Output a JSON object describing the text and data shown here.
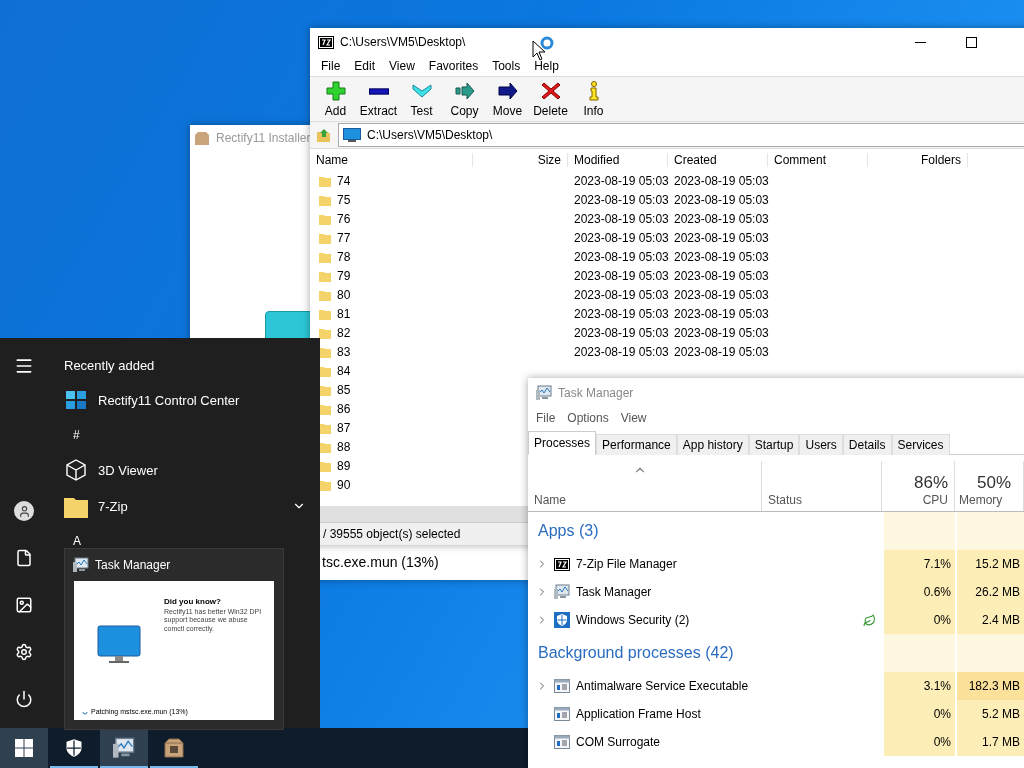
{
  "installer": {
    "title": "Rectify11 Installer",
    "status": "tsc.exe.mun (13%)"
  },
  "zip": {
    "title": "C:\\Users\\VM5\\Desktop\\",
    "menu": [
      "File",
      "Edit",
      "View",
      "Favorites",
      "Tools",
      "Help"
    ],
    "toolbar": [
      {
        "kind": "add",
        "label": "Add"
      },
      {
        "kind": "extract",
        "label": "Extract"
      },
      {
        "kind": "test",
        "label": "Test"
      },
      {
        "kind": "copy",
        "label": "Copy"
      },
      {
        "kind": "move",
        "label": "Move"
      },
      {
        "kind": "delete",
        "label": "Delete"
      },
      {
        "kind": "info",
        "label": "Info"
      }
    ],
    "address": "C:\\Users\\VM5\\Desktop\\",
    "columns": [
      "Name",
      "Size",
      "Modified",
      "Created",
      "Comment",
      "Folders"
    ],
    "rows": [
      {
        "name": "74",
        "modified": "2023-08-19 05:03",
        "created": "2023-08-19 05:03"
      },
      {
        "name": "75",
        "modified": "2023-08-19 05:03",
        "created": "2023-08-19 05:03"
      },
      {
        "name": "76",
        "modified": "2023-08-19 05:03",
        "created": "2023-08-19 05:03"
      },
      {
        "name": "77",
        "modified": "2023-08-19 05:03",
        "created": "2023-08-19 05:03"
      },
      {
        "name": "78",
        "modified": "2023-08-19 05:03",
        "created": "2023-08-19 05:03"
      },
      {
        "name": "79",
        "modified": "2023-08-19 05:03",
        "created": "2023-08-19 05:03"
      },
      {
        "name": "80",
        "modified": "2023-08-19 05:03",
        "created": "2023-08-19 05:03"
      },
      {
        "name": "81",
        "modified": "2023-08-19 05:03",
        "created": "2023-08-19 05:03"
      },
      {
        "name": "82",
        "modified": "2023-08-19 05:03",
        "created": "2023-08-19 05:03"
      },
      {
        "name": "83",
        "modified": "2023-08-19 05:03",
        "created": "2023-08-19 05:03"
      },
      {
        "name": "84"
      },
      {
        "name": "85"
      },
      {
        "name": "86"
      },
      {
        "name": "87"
      },
      {
        "name": "88"
      },
      {
        "name": "89"
      },
      {
        "name": "90"
      }
    ],
    "status": "/ 39555 object(s) selected"
  },
  "task_manager": {
    "title": "Task Manager",
    "menu": [
      "File",
      "Options",
      "View"
    ],
    "tabs": [
      {
        "label": "Processes",
        "selected": true
      },
      {
        "label": "Performance",
        "selected": false
      },
      {
        "label": "App history",
        "selected": false
      },
      {
        "label": "Startup",
        "selected": false
      },
      {
        "label": "Users",
        "selected": false
      },
      {
        "label": "Details",
        "selected": false
      },
      {
        "label": "Services",
        "selected": false
      }
    ],
    "columns": {
      "name": "Name",
      "status": "Status",
      "cpu_total": "86%",
      "cpu": "CPU",
      "memory_total": "50%",
      "memory": "Memory"
    },
    "groups": [
      {
        "title": "Apps (3)",
        "rows": [
          {
            "kind": "zip",
            "name": "7-Zip File Manager",
            "expandable": true,
            "efficiency": false,
            "cpu": "7.1%",
            "memory": "15.2 MB"
          },
          {
            "kind": "taskmgr",
            "name": "Task Manager",
            "expandable": true,
            "efficiency": false,
            "cpu": "0.6%",
            "memory": "26.2 MB"
          },
          {
            "kind": "security",
            "name": "Windows Security (2)",
            "expandable": true,
            "efficiency": true,
            "cpu": "0%",
            "memory": "2.4 MB"
          }
        ]
      },
      {
        "title": "Background processes (42)",
        "rows": [
          {
            "kind": "service",
            "name": "Antimalware Service Executable",
            "expandable": true,
            "efficiency": false,
            "cpu": "3.1%",
            "memory": "182.3 MB"
          },
          {
            "kind": "service",
            "name": "Application Frame Host",
            "expandable": false,
            "efficiency": false,
            "cpu": "0%",
            "memory": "5.2 MB"
          },
          {
            "kind": "service",
            "name": "COM Surrogate",
            "expandable": false,
            "efficiency": false,
            "cpu": "0%",
            "memory": "1.7 MB"
          }
        ]
      }
    ]
  },
  "start_menu": {
    "heading": "Recently added",
    "items": [
      {
        "kind": "app",
        "label": "Rectify11 Control Center"
      },
      {
        "kind": "letter",
        "label": "#"
      },
      {
        "kind": "app",
        "label": "3D Viewer"
      },
      {
        "kind": "folder",
        "label": "7-Zip",
        "expanded": false
      },
      {
        "kind": "letter",
        "label": "A"
      }
    ]
  },
  "thumbnail": {
    "title": "Task Manager",
    "heading": "Did you know?",
    "body": "Rectify11 has better Win32 DPI support because we abuse comctl correctly.",
    "progress": "Patching mstsc.exe.mun (13%)"
  },
  "taskbar": [
    {
      "kind": "start",
      "active": true,
      "running": false
    },
    {
      "kind": "security",
      "active": false,
      "running": true
    },
    {
      "kind": "taskmgr",
      "active": true,
      "running": true
    },
    {
      "kind": "installer",
      "active": false,
      "running": true
    }
  ]
}
